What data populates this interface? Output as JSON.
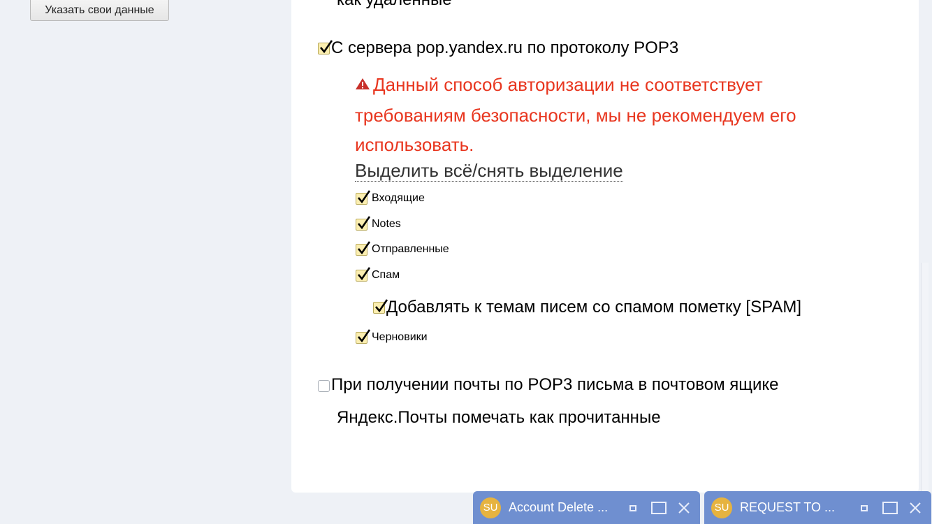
{
  "sidebar": {
    "button_label": "Указать свои данные"
  },
  "content": {
    "cut_text": "как удаленные",
    "pop3_label": "С сервера pop.yandex.ru по протоколу POP3",
    "warning": "Данный способ авторизации не соответствует требованиям безопасности, мы не рекомендуем его использовать.",
    "select_all": "Выделить всё/снять выделение",
    "folders": [
      {
        "label": "Входящие",
        "checked": true
      },
      {
        "label": "Notes",
        "checked": true
      },
      {
        "label": "Отправленные",
        "checked": true
      },
      {
        "label": "Спам",
        "checked": true
      },
      {
        "label": "Черновики",
        "checked": true
      }
    ],
    "spam_option": "Добавлять к темам писем со спамом пометку [SPAM]",
    "mark_read_line1": "При получении почты по POP3 письма в почтовом ящике",
    "mark_read_line2": "Яндекс.Почты помечать как прочитанные"
  },
  "chats": [
    {
      "initials": "SU",
      "title": "Account Delete ..."
    },
    {
      "initials": "SU",
      "title": "REQUEST TO ..."
    }
  ],
  "colors": {
    "warning": "#e8361f",
    "chat_bar": "#6f8fd0",
    "avatar": "#e6b340",
    "checkbox_fill": "#fbeeb0"
  }
}
